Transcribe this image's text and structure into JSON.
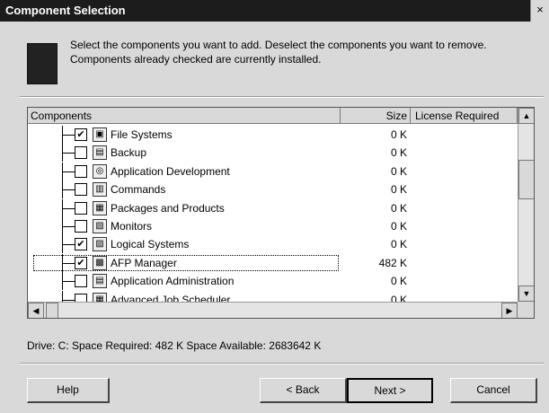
{
  "window": {
    "title": "Component Selection",
    "close_glyph": "×"
  },
  "instructions": "Select the components you want to add.  Deselect the components you want to remove.  Components already checked are currently installed.",
  "columns": {
    "components": "Components",
    "size": "Size",
    "license": "License Required"
  },
  "rows": [
    {
      "checked": true,
      "icon": "file-systems-icon",
      "glyph": "▣",
      "name": "File Systems",
      "size": "0 K"
    },
    {
      "checked": false,
      "icon": "backup-icon",
      "glyph": "▤",
      "name": "Backup",
      "size": "0 K"
    },
    {
      "checked": false,
      "icon": "app-dev-icon",
      "glyph": "◎",
      "name": "Application Development",
      "size": "0 K"
    },
    {
      "checked": false,
      "icon": "commands-icon",
      "glyph": "▥",
      "name": "Commands",
      "size": "0 K"
    },
    {
      "checked": false,
      "icon": "packages-icon",
      "glyph": "▦",
      "name": "Packages and Products",
      "size": "0 K"
    },
    {
      "checked": false,
      "icon": "monitors-icon",
      "glyph": "▧",
      "name": "Monitors",
      "size": "0 K"
    },
    {
      "checked": true,
      "icon": "logical-systems-icon",
      "glyph": "▨",
      "name": "Logical Systems",
      "size": "0 K"
    },
    {
      "checked": true,
      "icon": "afp-manager-icon",
      "glyph": "▩",
      "name": "AFP Manager",
      "size": "482 K",
      "selected": true
    },
    {
      "checked": false,
      "icon": "app-admin-icon",
      "glyph": "▤",
      "name": "Application Administration",
      "size": "0 K"
    },
    {
      "checked": false,
      "icon": "job-scheduler-icon",
      "glyph": "▦",
      "name": "Advanced Job Scheduler",
      "size": "0 K"
    }
  ],
  "status": "Drive:  C:   Space Required:  482 K   Space Available:  2683642 K",
  "buttons": {
    "help": "Help",
    "back": "< Back",
    "next": "Next >",
    "cancel": "Cancel"
  },
  "scroll": {
    "up": "▲",
    "down": "▼",
    "left": "◀",
    "right": "▶"
  }
}
